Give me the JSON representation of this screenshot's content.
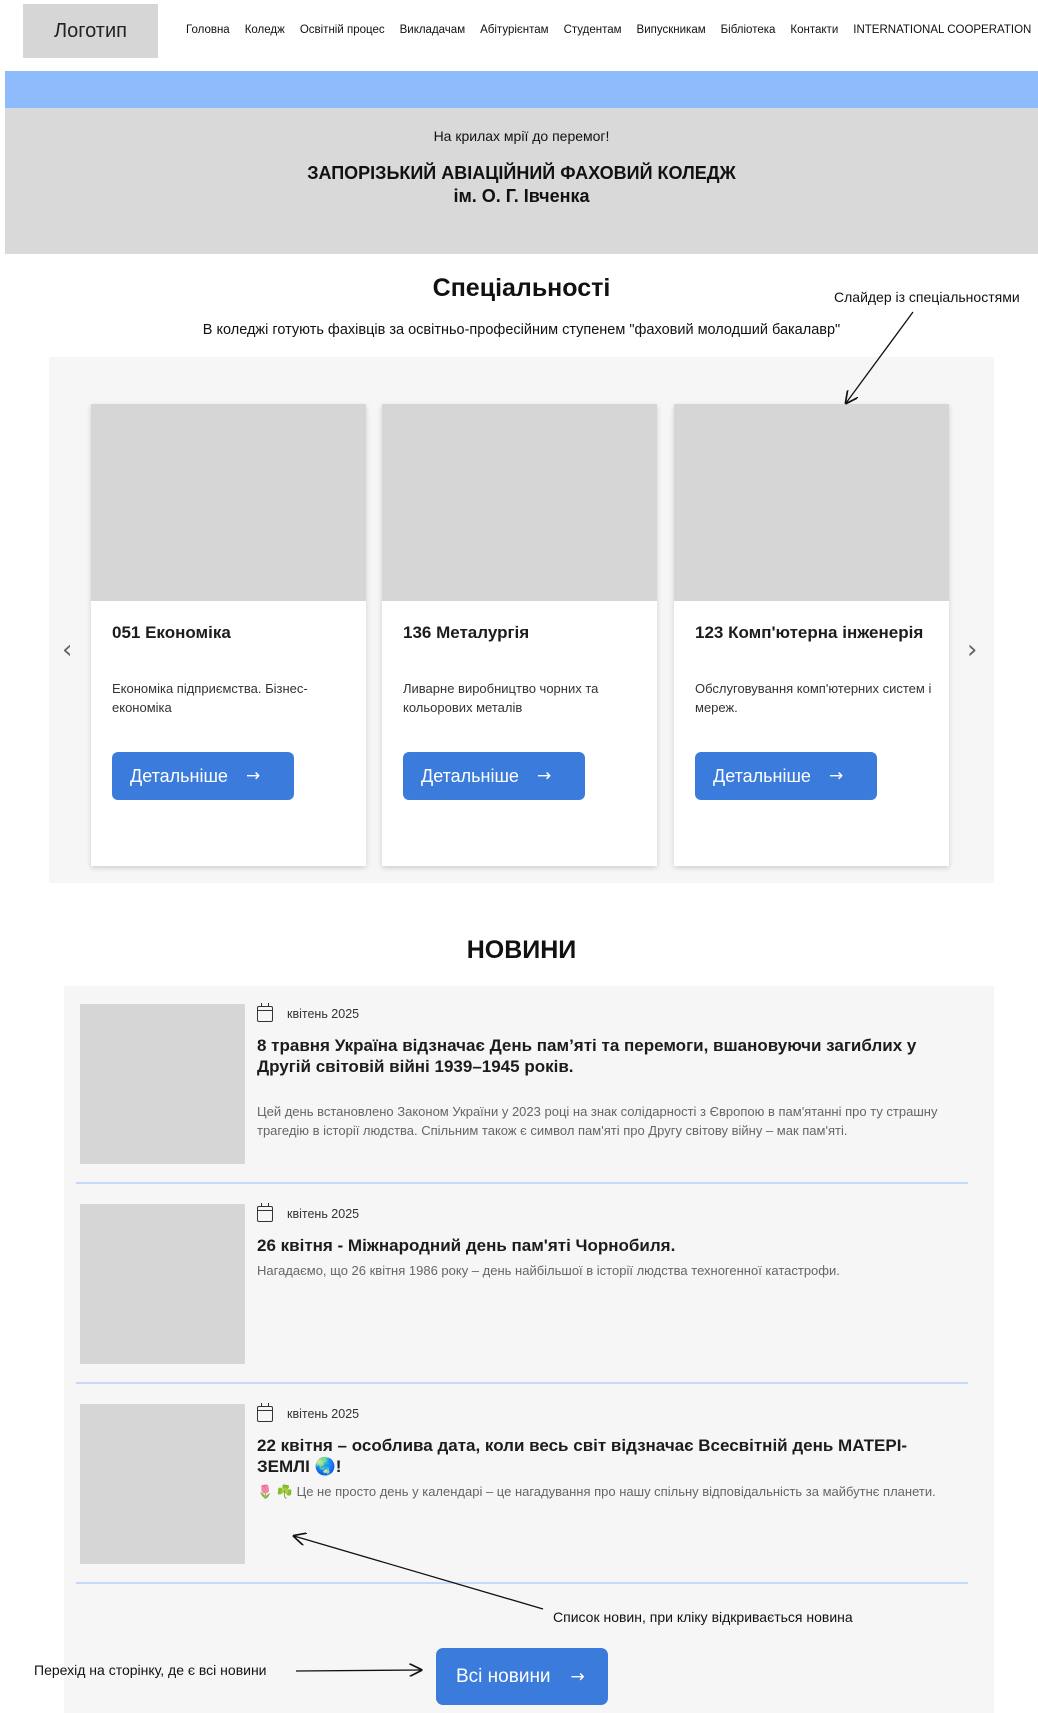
{
  "header": {
    "logo_text": "Логотип",
    "nav": [
      "Головна",
      "Коледж",
      "Освітній процес",
      "Викладачам",
      "Абітурієнтам",
      "Студентам",
      "Випускникам",
      "Бібліотека",
      "Контакти",
      "INTERNATIONAL  COOPERATION"
    ]
  },
  "hero": {
    "motto": "На крилах мрії до перемог!",
    "title_line1": "ЗАПОРІЗЬКИЙ АВІАЦІЙНИЙ ФАХОВИЙ КОЛЕДЖ",
    "title_line2": "ім. О. Г. Івченка",
    "colors": {
      "band": "#8ebbfb",
      "hero_bg": "#d9d9d9"
    }
  },
  "specialties": {
    "title": "Спеціальності",
    "subtitle": "В коледжі готують фахівців за освітньо-професійним ступенем \"фаховий молодший бакалавр\"",
    "prev_icon": "chevron-left-icon",
    "next_icon": "chevron-right-icon",
    "cards": [
      {
        "name": "051 Економіка",
        "desc": "Економіка підприємства. Бізнес-економіка",
        "button": "Детальніше"
      },
      {
        "name": "136 Металургія",
        "desc": "Ливарне виробництво чорних та кольорових металів",
        "button": "Детальніше"
      },
      {
        "name": "123 Комп'ютерна інженерія",
        "desc": "Обслуговування комп'ютерних систем і мереж.",
        "button": "Детальніше"
      }
    ]
  },
  "news": {
    "title": "НОВИНИ",
    "items": [
      {
        "date": "квітень 2025",
        "headline": "8 травня Україна відзначає День пам’яті та перемоги, вшановуючи загиблих у Другій світовій війні 1939–1945 років.",
        "excerpt": "Цей день встановлено Законом України у 2023 році на знак солідарності з Європою в пам'ятанні про ту страшну трагедію в історії людства. Спільним також є символ пам'яті про Другу світову війну – мак пам'яті."
      },
      {
        "date": "квітень 2025",
        "headline": "26 квітня - Міжнародний день пам'яті Чорнобиля.",
        "excerpt": "Нагадаємо, що 26 квітня 1986 року – день найбільшої в історії людства техногенної катастрофи."
      },
      {
        "date": "квітень 2025",
        "headline": "22 квітня – особлива дата, коли весь світ відзначає Всесвітній день МАТЕРІ-ЗЕМЛІ 🌏!",
        "excerpt": "🌷 ☘️ Це не просто день у календарі – це нагадування про нашу спільну відповідальність за майбутнє планети."
      }
    ],
    "all_button": "Всі новини"
  },
  "annotations": {
    "slider_note": "Слайдер із спеціальностями",
    "news_list_note": "Список новин, при кліку відкривається новина",
    "all_news_note": "Перехід на сторінку, де є всі новини"
  },
  "colors": {
    "accent": "#3a7bdb",
    "panel_bg": "#f6f6f7",
    "placeholder": "#d6d6d6",
    "divider": "#c6d9f6"
  }
}
